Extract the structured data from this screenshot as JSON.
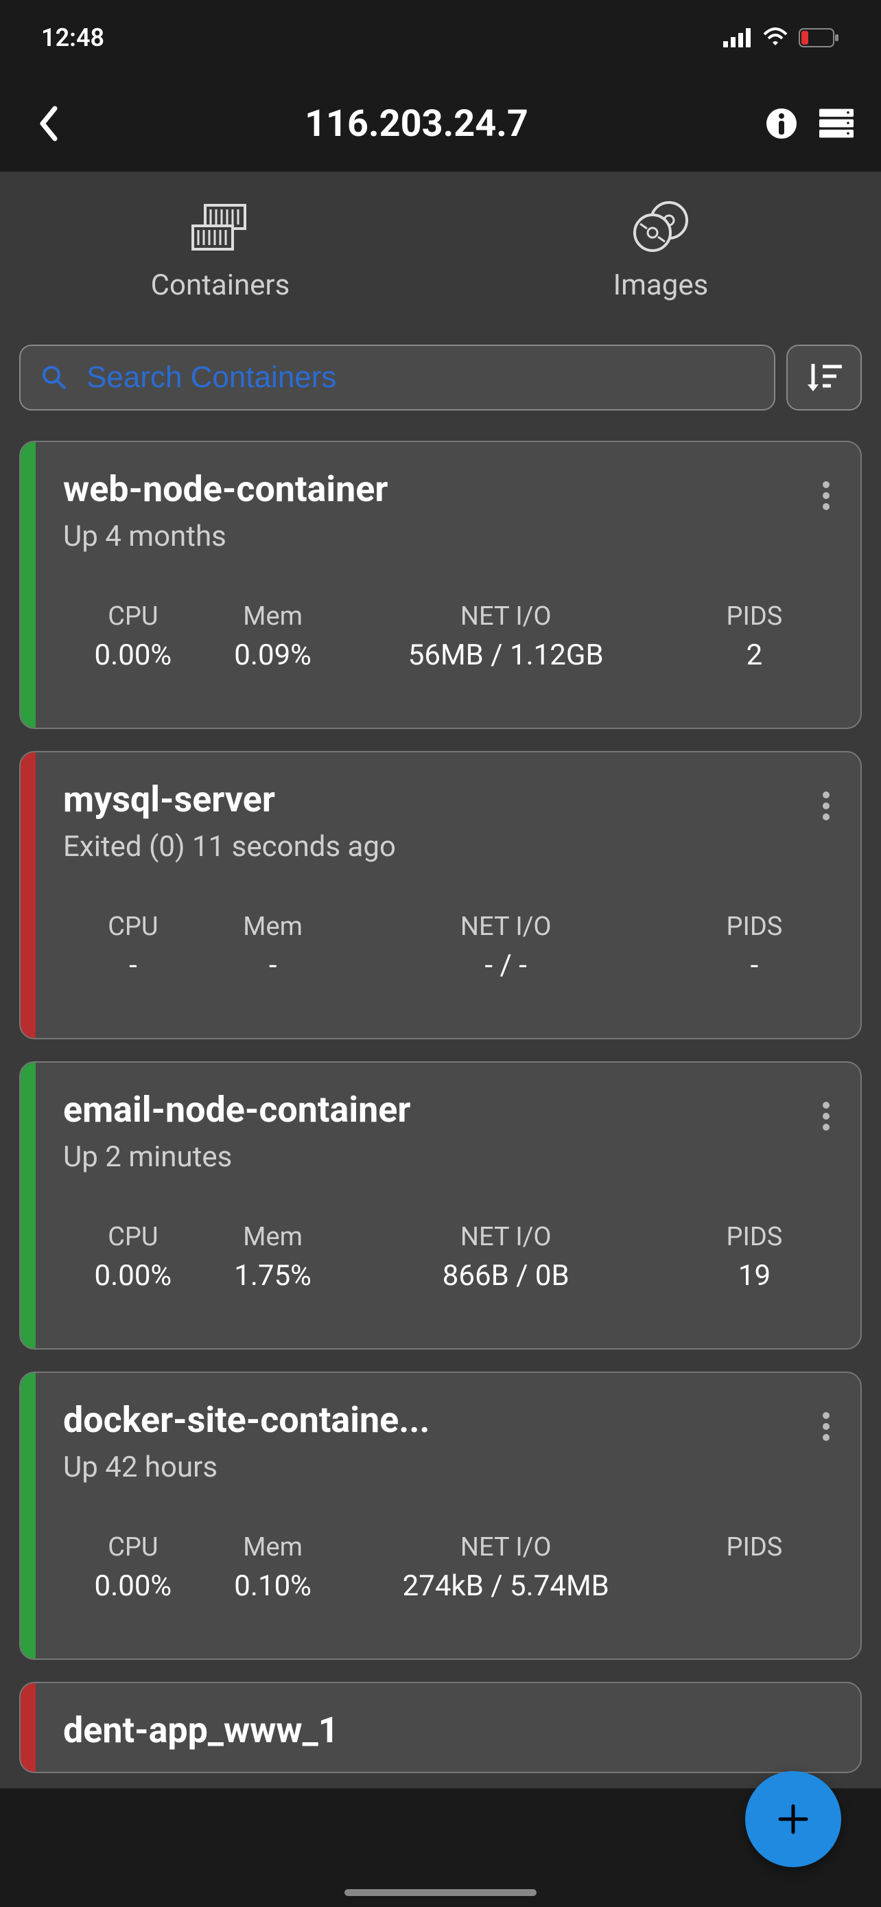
{
  "status_bar": {
    "time": "12:48"
  },
  "header": {
    "title": "116.203.24.7"
  },
  "tabs": {
    "containers": "Containers",
    "images": "Images"
  },
  "search": {
    "placeholder": "Search Containers"
  },
  "stat_labels": {
    "cpu": "CPU",
    "mem": "Mem",
    "netio": "NET I/O",
    "pids": "PIDS"
  },
  "containers": [
    {
      "name": "web-node-container",
      "status": "Up 4 months",
      "running": true,
      "cpu": "0.00%",
      "mem": "0.09%",
      "netio": "56MB / 1.12GB",
      "pids": "2"
    },
    {
      "name": "mysql-server",
      "status": "Exited (0) 11 seconds ago",
      "running": false,
      "cpu": "-",
      "mem": "-",
      "netio": "- / -",
      "pids": "-"
    },
    {
      "name": "email-node-container",
      "status": "Up 2 minutes",
      "running": true,
      "cpu": "0.00%",
      "mem": "1.75%",
      "netio": "866B / 0B",
      "pids": "19"
    },
    {
      "name": "docker-site-containe...",
      "status": "Up 42 hours",
      "running": true,
      "cpu": "0.00%",
      "mem": "0.10%",
      "netio": "274kB / 5.74MB",
      "pids": ""
    },
    {
      "name": "dent-app_www_1",
      "status": "",
      "running": false,
      "cpu": "",
      "mem": "",
      "netio": "",
      "pids": ""
    }
  ]
}
